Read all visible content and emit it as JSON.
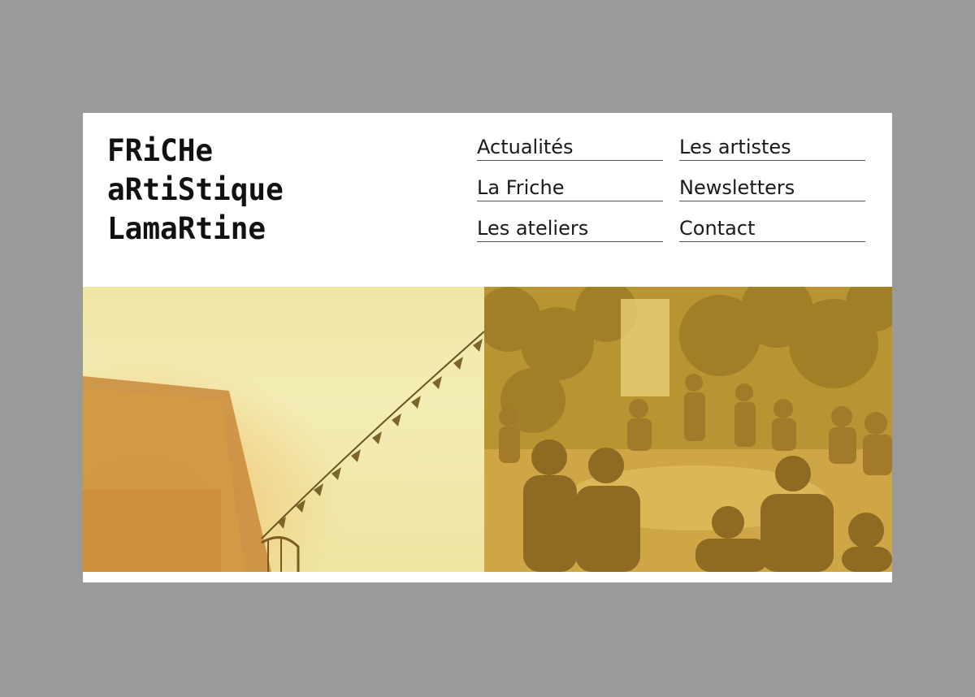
{
  "logo": {
    "line1": "FRiCHe",
    "line2": "aRtiStique",
    "line3": "LamaRtine"
  },
  "nav": {
    "items": [
      {
        "label": "Actualités"
      },
      {
        "label": "Les artistes"
      },
      {
        "label": "La Friche"
      },
      {
        "label": "Newsletters"
      },
      {
        "label": "Les ateliers"
      },
      {
        "label": "Contact"
      }
    ]
  },
  "colors": {
    "frame": "#9a9a9a",
    "page": "#ffffff",
    "text": "#1a1a1a",
    "hero_left_tint": "#efe6a4",
    "hero_right_tint": "#c9a63a"
  }
}
